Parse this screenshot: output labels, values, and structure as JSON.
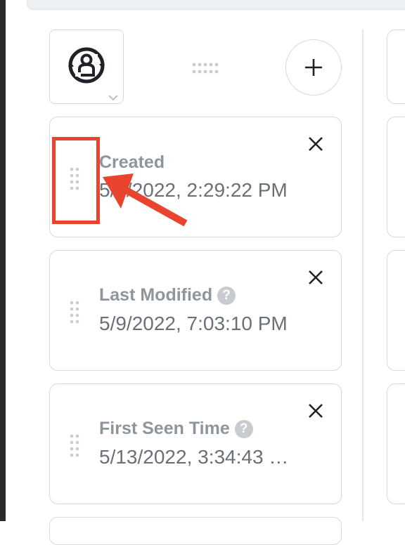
{
  "cards": [
    {
      "label": "Created",
      "value": "5/9/2022, 2:29:22 PM",
      "has_help": false
    },
    {
      "label": "Last Modified",
      "value": "5/9/2022, 7:03:10 PM",
      "has_help": true
    },
    {
      "label": "First Seen Time",
      "value": "5/13/2022, 3:34:43 …",
      "has_help": true
    }
  ],
  "help_glyph": "?",
  "colors": {
    "annotation": "#e8442e",
    "border": "#d5dade",
    "label": "#8e959c",
    "value": "#6a7077",
    "help_badge": "#c8ccd0"
  },
  "icons": {
    "entity_type": "user-identity-sync-icon",
    "add": "plus-icon",
    "close": "close-x-icon",
    "drag": "drag-grip-icon",
    "dropdown": "chevron-down-icon",
    "help": "help-circle-icon"
  }
}
